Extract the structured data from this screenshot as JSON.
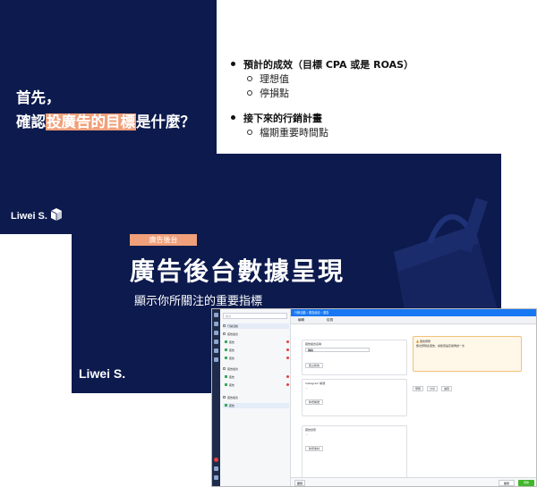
{
  "slide1": {
    "title_line1": "首先，",
    "title_pre": "確認",
    "title_highlight": "投廣告的目標",
    "title_post": "是什麼？",
    "brand": "Liwei S.",
    "bullets": [
      {
        "text": "預計的成效（目標 CPA 或是 ROAS）",
        "subs": [
          "理想值",
          "停損點"
        ]
      },
      {
        "text": "接下來的行銷計畫",
        "subs": [
          "檔期重要時間點"
        ]
      }
    ]
  },
  "slide2": {
    "tag": "廣告後台",
    "title": "廣告後台數據呈現",
    "subtitle": "顯示你所關注的重要指標",
    "brand": "Liwei S."
  },
  "screenshot": {
    "search_placeholder": "搜尋",
    "topbar_text": "行銷活動 › 廣告組合 › 廣告",
    "tabs": [
      "編輯",
      "檢視"
    ],
    "tree_rows": [
      "行銷活動",
      "廣告組合",
      "廣告",
      "廣告",
      "廣告",
      "廣告組合",
      "廣告",
      "廣告",
      "廣告組合",
      "廣告"
    ],
    "card1_title": "廣告組合名稱",
    "card1_select": "轉換",
    "card1_button": "建立新的",
    "card2_title": "Instagram 帳號",
    "card2_button": "新增帳號",
    "card3_title": "廣告創意",
    "card3_button": "新增素材",
    "notice_title": "廣告預覽",
    "notice_body": "無法預覽此廣告，請檢查設定後再試一次",
    "controls": [
      "預覽",
      "分享",
      "進階"
    ],
    "bottom_left": "關閉",
    "bottom_close": "關閉",
    "bottom_publish": "發佈"
  },
  "colors": {
    "navy": "#0c1a4d",
    "highlight": "#f0a07a",
    "fb_blue": "#1877f2",
    "publish_green": "#42b72a"
  }
}
